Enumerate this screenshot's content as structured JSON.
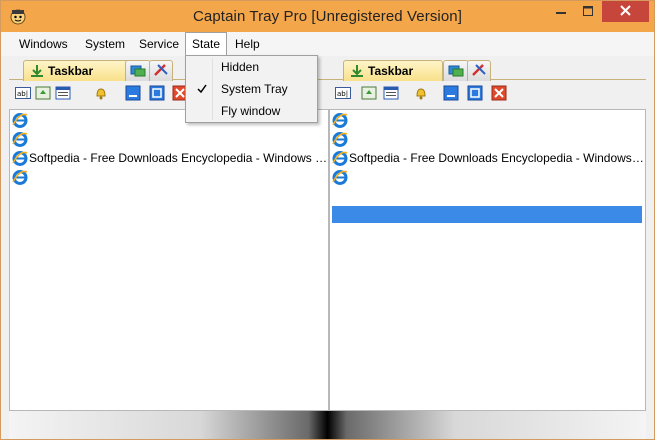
{
  "window": {
    "title": "Captain Tray Pro  [Unregistered Version]"
  },
  "menu": {
    "items": [
      "Windows",
      "System",
      "Service",
      "State",
      "Help"
    ],
    "active": "State"
  },
  "dropdown": {
    "items": [
      {
        "label": "Hidden",
        "checked": false
      },
      {
        "label": "System Tray",
        "checked": true
      },
      {
        "label": "Fly window",
        "checked": false
      }
    ]
  },
  "left_pane": {
    "tab_label": "Taskbar",
    "rows": [
      "",
      "",
      "Softpedia - Free Downloads Encyclopedia - Windows I...",
      ""
    ]
  },
  "right_pane": {
    "tab_label": "Taskbar",
    "rows": [
      "",
      "",
      "Softpedia - Free Downloads Encyclopedia - Windows ...",
      ""
    ]
  },
  "colors": {
    "title_bar": "#f4a64a",
    "close_button": "#c7463c",
    "selection": "#3c8ae8"
  }
}
